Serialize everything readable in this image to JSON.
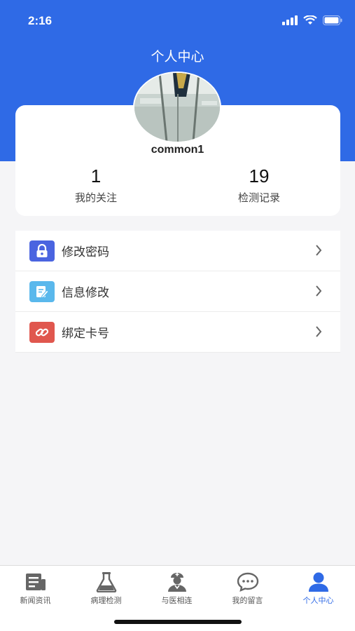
{
  "status_bar": {
    "time": "2:16"
  },
  "header": {
    "title": "个人中心"
  },
  "profile": {
    "username": "common1",
    "stats": [
      {
        "value": "1",
        "label": "我的关注"
      },
      {
        "value": "19",
        "label": "检测记录"
      }
    ]
  },
  "menu": {
    "items": [
      {
        "label": "修改密码",
        "icon": "lock-icon",
        "color": "#4a64e0"
      },
      {
        "label": "信息修改",
        "icon": "edit-icon",
        "color": "#5ab8ec"
      },
      {
        "label": "绑定卡号",
        "icon": "link-icon",
        "color": "#e0574e"
      }
    ]
  },
  "tabbar": {
    "accent": "#2f6ae6",
    "tabs": [
      {
        "label": "新闻资讯",
        "icon": "news-icon"
      },
      {
        "label": "病理检测",
        "icon": "flask-icon"
      },
      {
        "label": "与医相连",
        "icon": "doctor-icon"
      },
      {
        "label": "我的留言",
        "icon": "chat-icon"
      },
      {
        "label": "个人中心",
        "icon": "user-icon",
        "active": true
      }
    ]
  }
}
